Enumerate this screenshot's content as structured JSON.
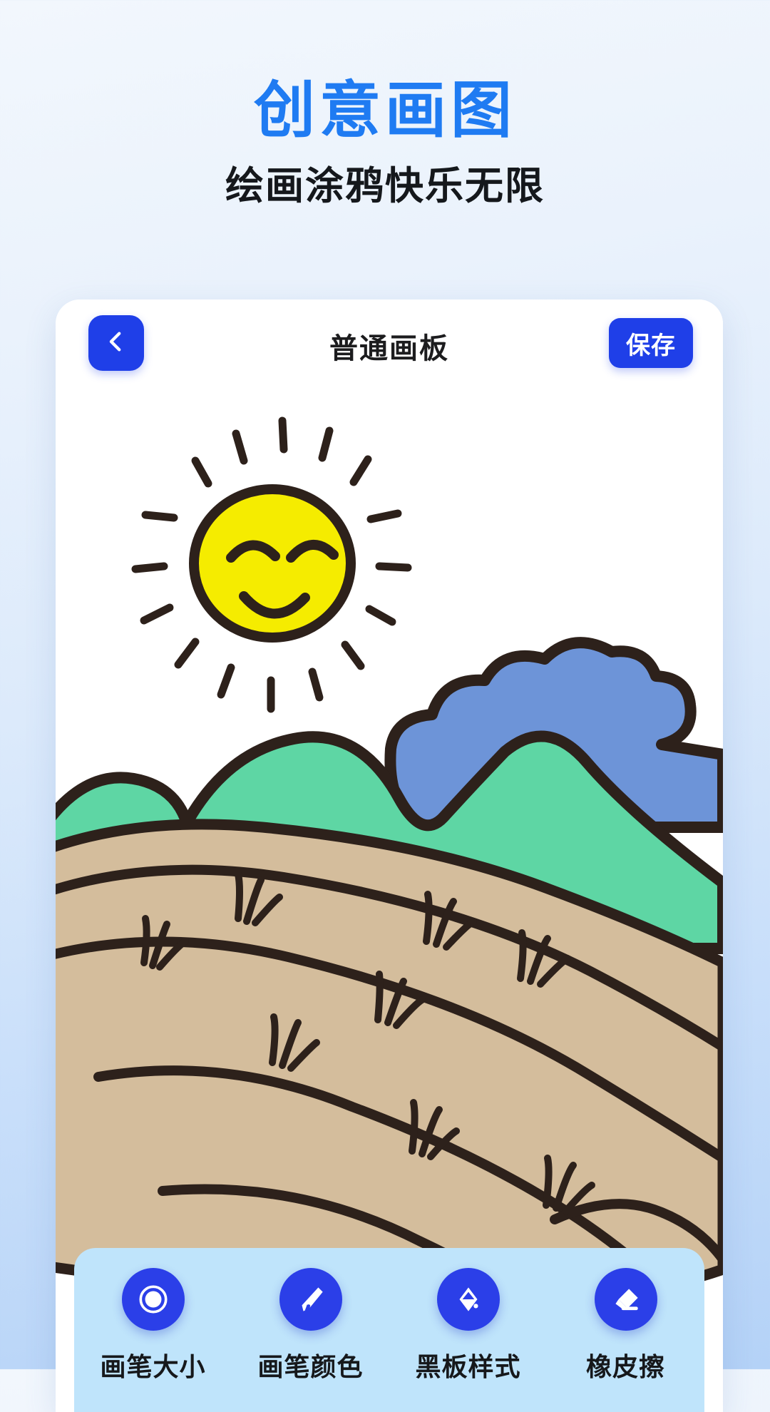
{
  "promo": {
    "title": "创意画图",
    "subtitle": "绘画涂鸦快乐无限",
    "title_color": "#1f7bf2",
    "subtitle_color": "#15181c"
  },
  "app": {
    "appbar": {
      "back_icon": "chevron-left-icon",
      "title": "普通画板",
      "save_label": "保存",
      "button_color": "#1f3fe8"
    },
    "canvas": {
      "background": "#ffffff",
      "drawing_name": "sun-mountains-terraced-fields-doodle",
      "colors": {
        "ink": "#2d211b",
        "sun": "#f5ec00",
        "hill": "#5ed6a4",
        "cloud": "#6d94d8",
        "field": "#d4bd9c"
      }
    },
    "toolbar": {
      "panel_color": "#bfe4fb",
      "icon_color": "#2b3fe8",
      "items": [
        {
          "label": "画笔大小",
          "icon": "brush-size-circle-icon"
        },
        {
          "label": "画笔颜色",
          "icon": "pen-nib-icon"
        },
        {
          "label": "黑板样式",
          "icon": "paint-bucket-icon"
        },
        {
          "label": "橡皮擦",
          "icon": "eraser-icon"
        }
      ]
    }
  }
}
